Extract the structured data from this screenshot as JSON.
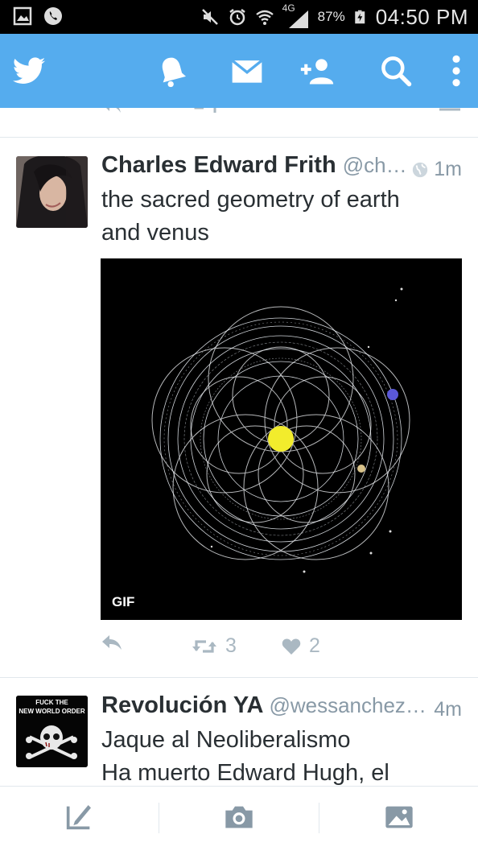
{
  "status_bar": {
    "network": "4G",
    "battery": "87%",
    "time": "04:50 PM"
  },
  "header": {
    "icons": [
      "twitter-bird-icon",
      "notifications-bell-icon",
      "messages-envelope-icon",
      "add-user-icon",
      "search-icon",
      "overflow-menu-icon"
    ],
    "color": "#55acee"
  },
  "tweets": [
    {
      "name": "Charles Edward Frith",
      "handle": "@ch…",
      "time": "1m",
      "text_lines": [
        "the sacred geometry of earth",
        "and venus"
      ],
      "media_badge": "GIF",
      "retweets": "3",
      "likes": "2"
    },
    {
      "name": "Revolución YA",
      "handle": "@wessanchez…",
      "time": "4m",
      "avatar_text_line1": "FUCK THE",
      "avatar_text_line2": "NEW WORLD ORDER",
      "text_lines": [
        "Jaque al Neoliberalismo",
        "Ha muerto Edward Hugh, el"
      ]
    }
  ],
  "bottom_bar": {
    "icons": [
      "compose-tweet-icon",
      "camera-icon",
      "gallery-image-icon"
    ]
  }
}
